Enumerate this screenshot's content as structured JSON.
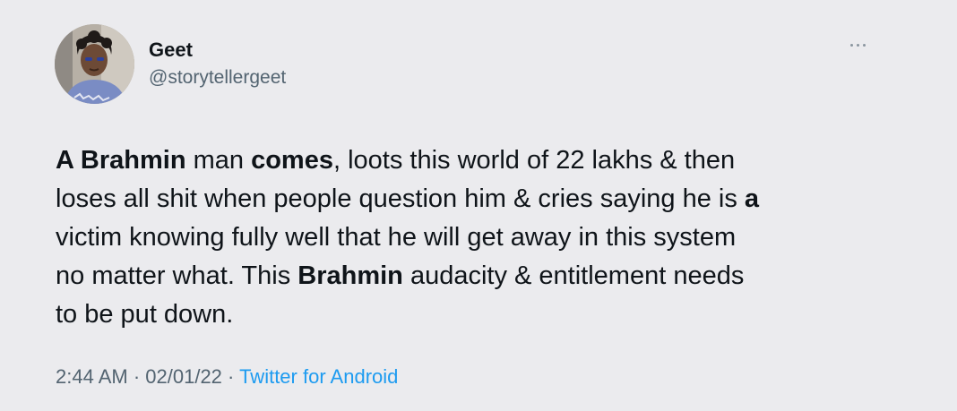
{
  "author": {
    "name": "Geet",
    "handle": "@storytellergeet"
  },
  "icons": {
    "more": "more-horizontal-icon",
    "avatar": "profile-photo"
  },
  "tweet": {
    "lines": [
      [
        {
          "t": "A Brahmin",
          "b": true
        },
        {
          "t": " man ",
          "b": false
        },
        {
          "t": "comes",
          "b": true
        },
        {
          "t": ", loots this world of 22 lakhs & then",
          "b": false
        }
      ],
      [
        {
          "t": "loses all shit when people question him & cries saying he is ",
          "b": false
        },
        {
          "t": "a",
          "b": true
        }
      ],
      [
        {
          "t": "victim knowing fully well that he will get away in this system",
          "b": false
        }
      ],
      [
        {
          "t": "no matter what. This ",
          "b": false
        },
        {
          "t": "Brahmin",
          "b": true
        },
        {
          "t": " audacity & entitlement needs",
          "b": false
        }
      ],
      [
        {
          "t": "to be put down.",
          "b": false
        }
      ]
    ]
  },
  "meta": {
    "time": "2:44 AM",
    "sep1": " · ",
    "date": "02/01/22",
    "sep2": " · ",
    "source": "Twitter for Android"
  },
  "colors": {
    "link": "#1d9bf0",
    "muted": "#536471",
    "text": "#0f1419",
    "background": "#ebebee"
  }
}
